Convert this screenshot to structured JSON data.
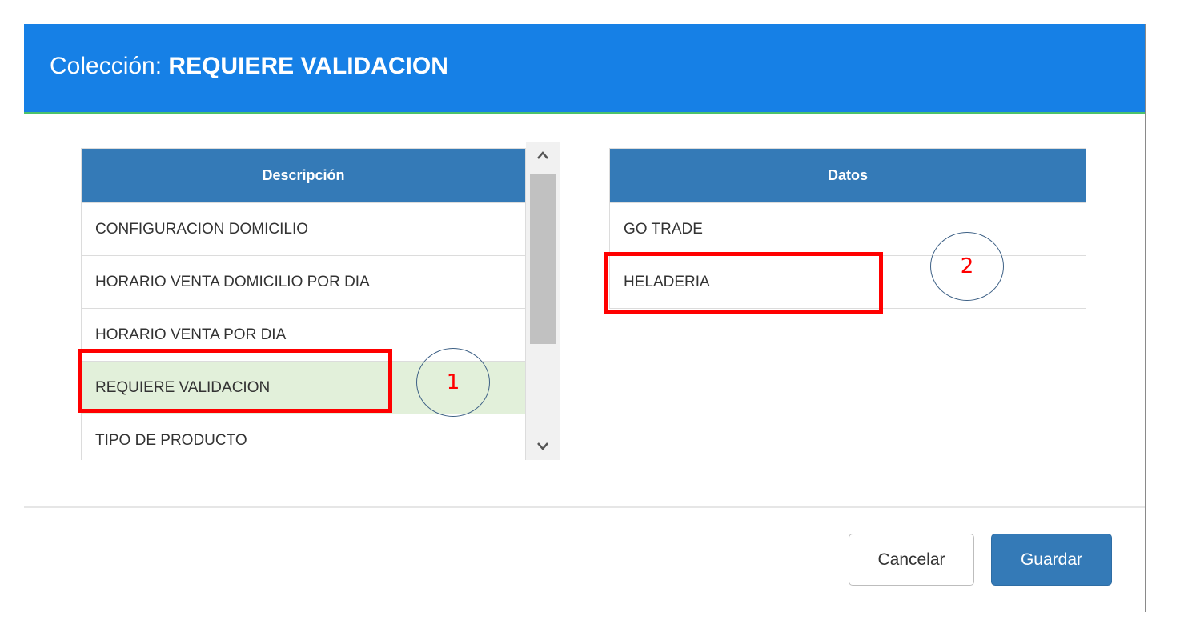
{
  "modal": {
    "title_prefix": "Colección:",
    "title_value": "REQUIERE VALIDACION"
  },
  "description_table": {
    "header": "Descripción",
    "rows": [
      "CONFIGURACION DOMICILIO",
      "HORARIO VENTA DOMICILIO POR DIA",
      "HORARIO VENTA POR DIA",
      "REQUIERE VALIDACION",
      "TIPO DE PRODUCTO"
    ],
    "selected_index": 3
  },
  "data_table": {
    "header": "Datos",
    "rows": [
      "GO TRADE",
      "HELADERIA"
    ]
  },
  "annotations": {
    "marker_1": "1",
    "marker_2": "2"
  },
  "footer": {
    "cancel_label": "Cancelar",
    "save_label": "Guardar"
  },
  "icons": {
    "scroll_up": "chevron-up-icon",
    "scroll_down": "chevron-down-icon"
  },
  "colors": {
    "header_bg": "#1680e6",
    "table_header_bg": "#347ab7",
    "selected_row_bg": "#e2f0da",
    "annotation_red": "#ff0000"
  }
}
